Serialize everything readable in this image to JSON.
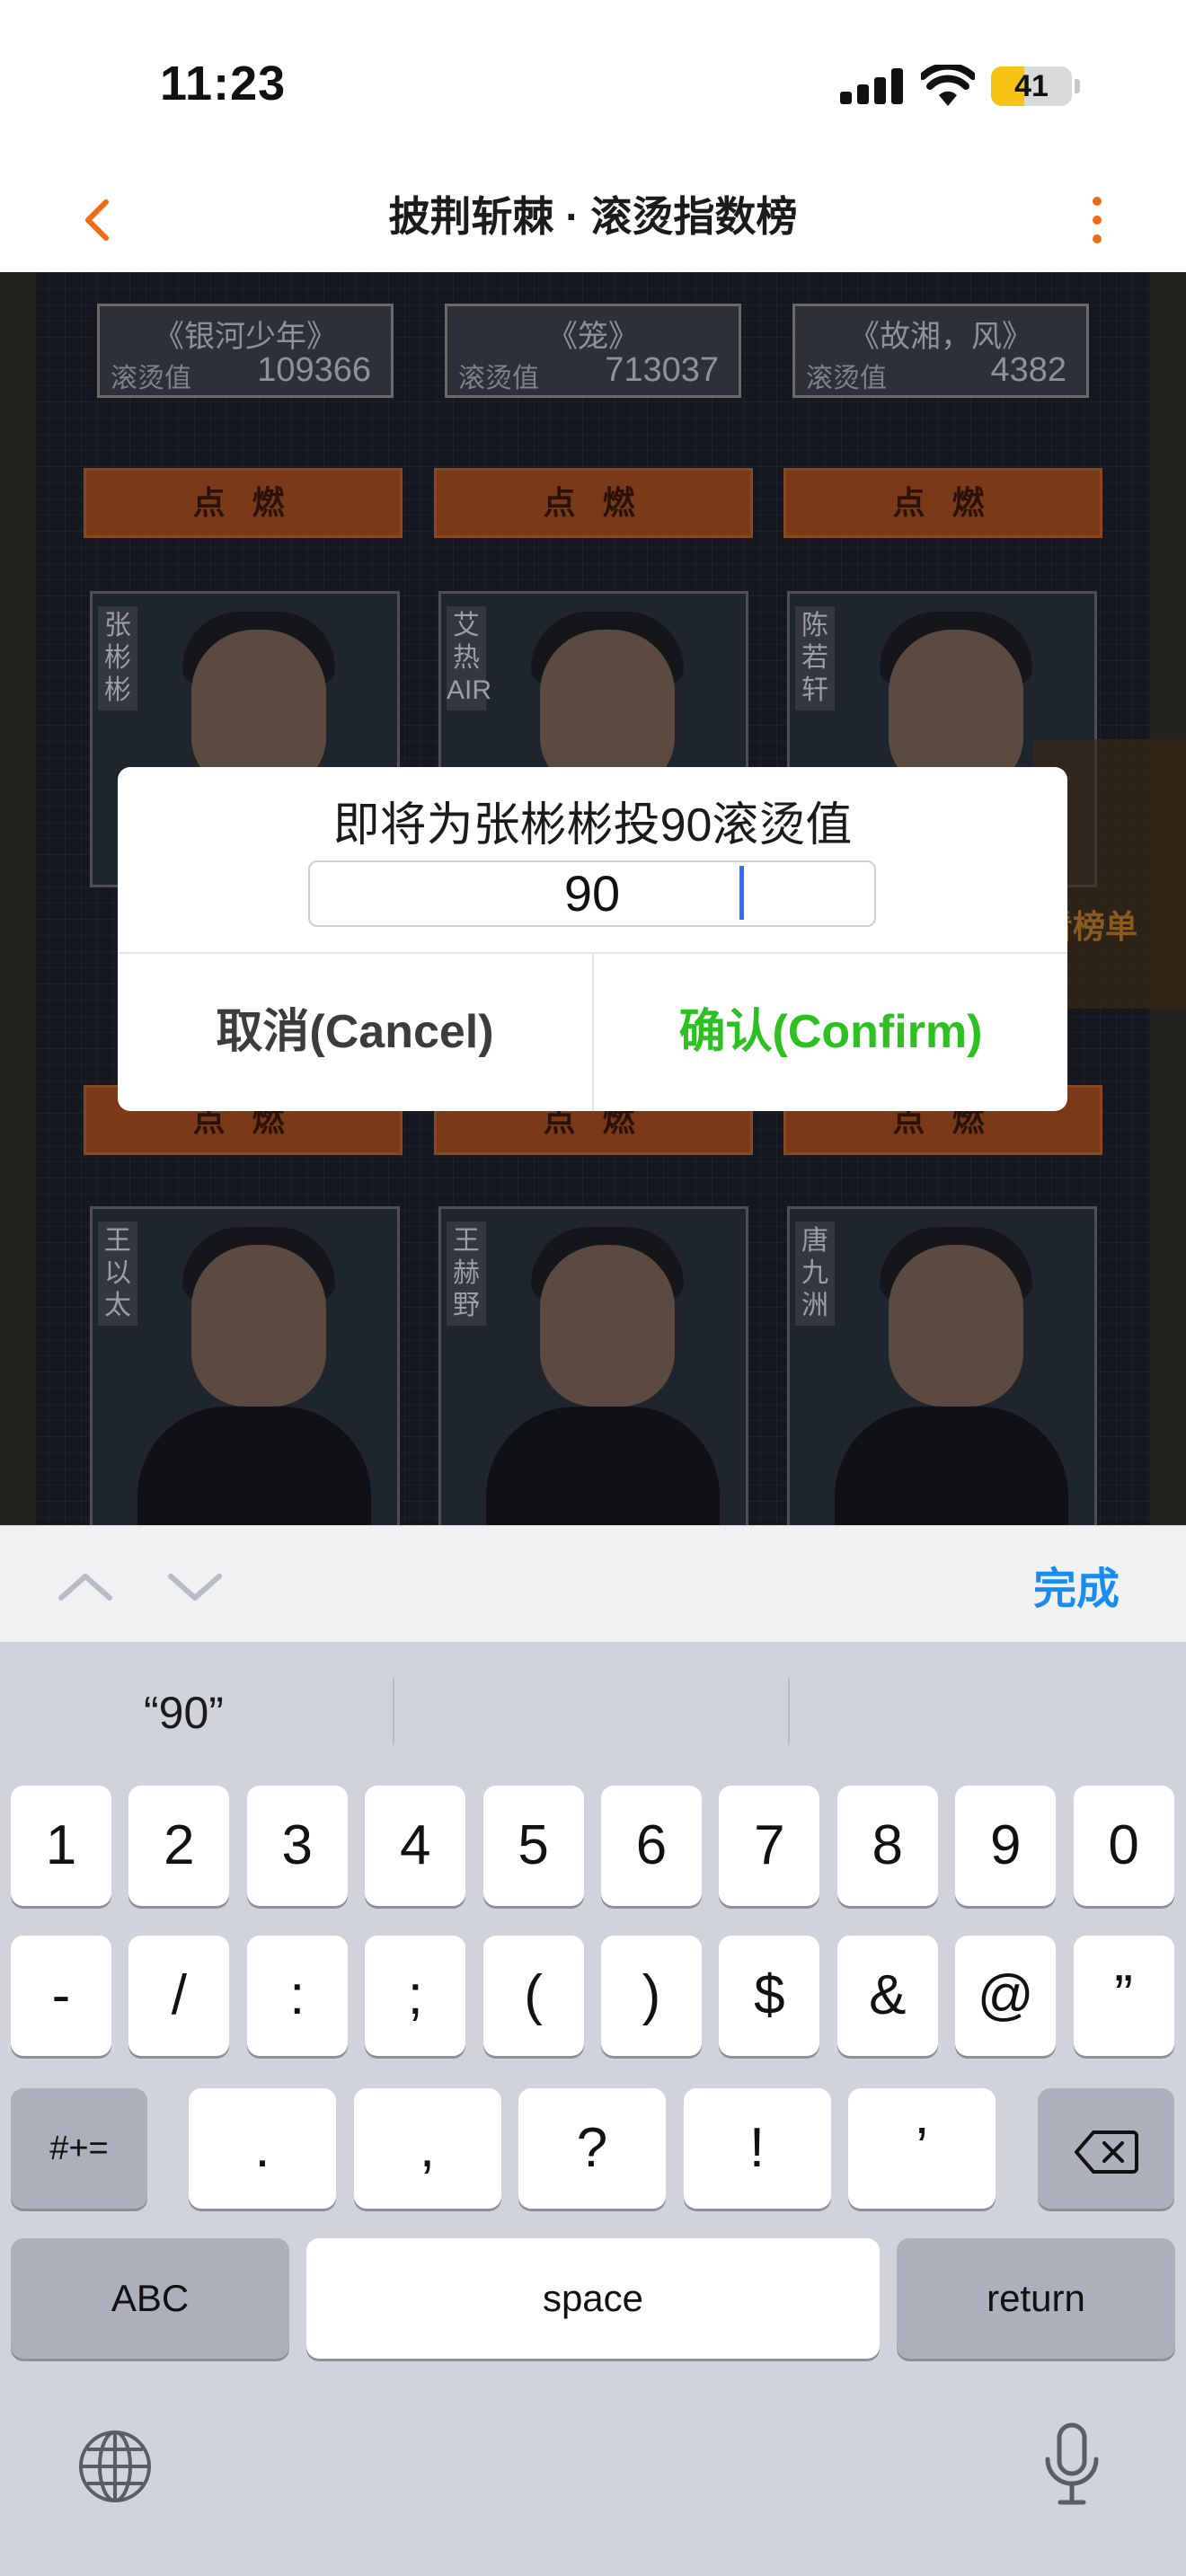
{
  "status_bar": {
    "time": "11:23",
    "battery": "41",
    "battery_level": 0.41
  },
  "nav": {
    "title": "披荆斩棘 · 滚烫指数榜"
  },
  "background": {
    "info_cards": [
      {
        "song": "《银河少年》",
        "hot_label": "滚烫值",
        "hot_value": "109366"
      },
      {
        "song": "《笼》",
        "hot_label": "滚烫值",
        "hot_value": "713037"
      },
      {
        "song": "《故湘，风》",
        "hot_label": "滚烫值",
        "hot_value": "4382"
      }
    ],
    "ignite_label": "点 燃",
    "row1_names": [
      "张彬彬",
      "艾热AIR",
      "陈若轩"
    ],
    "row2_names": [
      "王以太",
      "王赫野",
      "唐九洲"
    ],
    "side_banner": "看榜单"
  },
  "dialog": {
    "title": "即将为张彬彬投90滚烫值",
    "input_value": "90",
    "cancel_label": "取消(Cancel)",
    "confirm_label": "确认(Confirm)"
  },
  "accessory": {
    "done_label": "完成"
  },
  "keyboard": {
    "suggestion": "“90”",
    "row1": [
      "1",
      "2",
      "3",
      "4",
      "5",
      "6",
      "7",
      "8",
      "9",
      "0"
    ],
    "row2": [
      "-",
      "/",
      ":",
      ";",
      "(",
      ")",
      "$",
      "&",
      "@",
      "”"
    ],
    "row3": [
      ".",
      ",",
      "?",
      "!",
      "’"
    ],
    "symbols_key": "#+=",
    "abc_key": "ABC",
    "space_key": "space",
    "return_key": "return"
  },
  "colors": {
    "accent_orange": "#f26a11",
    "confirm_green": "#2cc021",
    "done_blue": "#1a8cf0",
    "battery_yellow": "#f5c313"
  }
}
